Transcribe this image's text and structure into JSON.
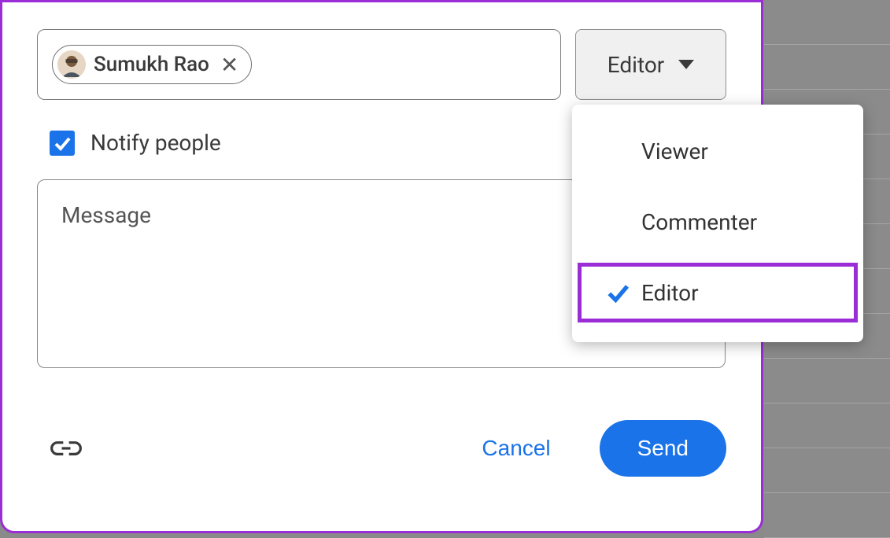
{
  "share": {
    "person_chip": {
      "name": "Sumukh Rao"
    },
    "role_button": {
      "label": "Editor"
    },
    "notify": {
      "label": "Notify people",
      "checked": true
    },
    "message_placeholder": "Message",
    "cancel_label": "Cancel",
    "send_label": "Send"
  },
  "role_dropdown": {
    "options": [
      {
        "label": "Viewer",
        "selected": false
      },
      {
        "label": "Commenter",
        "selected": false
      },
      {
        "label": "Editor",
        "selected": true
      }
    ]
  }
}
